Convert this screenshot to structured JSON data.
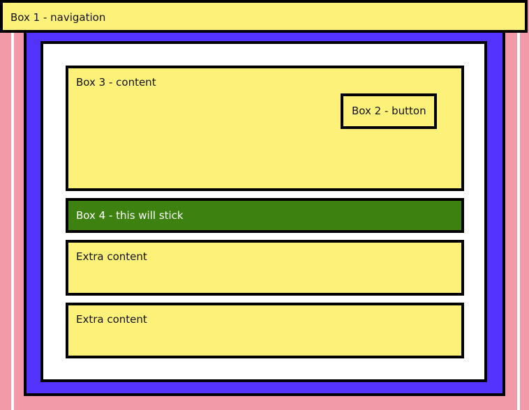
{
  "colors": {
    "page_background": "#f29aa8",
    "outer_frame": "#5533ff",
    "inner_panel": "#ffffff",
    "box_fill": "#fdf17a",
    "sticky_fill": "#3d8210",
    "border": "#000000"
  },
  "boxes": {
    "navigation": "Box 1 - navigation",
    "button": "Box 2 - button",
    "content": "Box 3 - content",
    "sticky": "Box 4 - this will stick",
    "extra": [
      "Extra content",
      "Extra content"
    ]
  }
}
